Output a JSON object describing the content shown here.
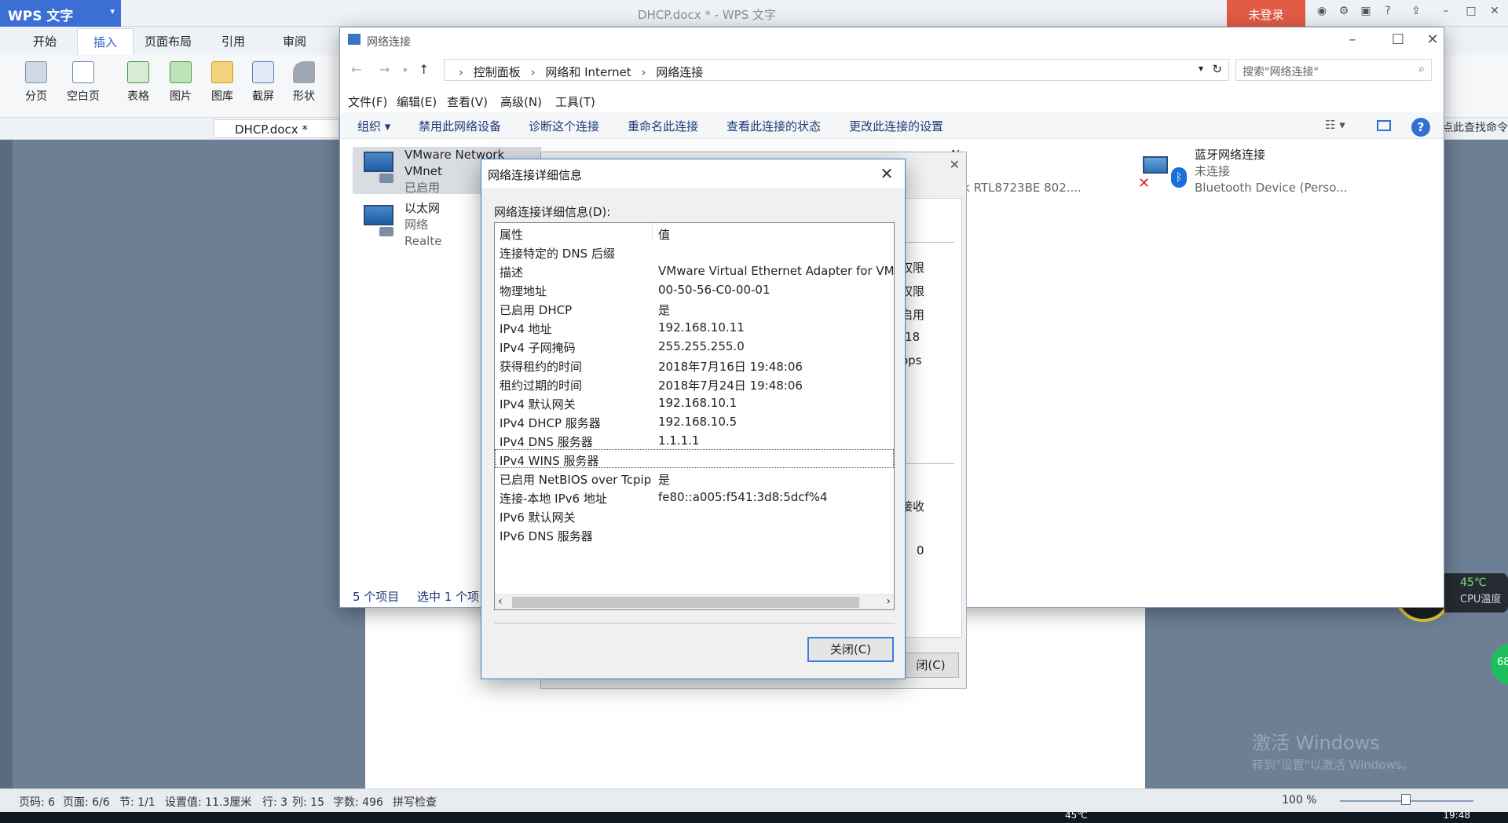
{
  "wps": {
    "app_name": "WPS 文字",
    "window_title": "DHCP.docx * - WPS 文字",
    "login_label": "未登录",
    "tabs": [
      "开始",
      "插入",
      "页面布局",
      "引用",
      "审阅"
    ],
    "active_tab": "插入",
    "ribbon": [
      "分页",
      "空白页",
      "表格",
      "图片",
      "图库",
      "截屏",
      "形状"
    ],
    "doc_tab": "DHCP.docx *",
    "find_hint": "点此查找命令",
    "status": {
      "page_code": "页码: 6",
      "pages": "页面: 6/6",
      "section": "节: 1/1",
      "setting": "设置值: 11.3厘米",
      "row": "行: 3",
      "col": "列: 15",
      "words": "字数: 496",
      "spell": "拼写检查",
      "zoom": "100 %"
    }
  },
  "watermark": {
    "line1": "激活 Windows",
    "line2": "转到\"设置\"以激活 Windows。"
  },
  "cpu": {
    "percent": "68",
    "unit": "%",
    "temp": "45℃",
    "label": "CPU温度",
    "ball": "68"
  },
  "taskbar": {
    "time": "19:48",
    "temp": "45℃"
  },
  "nc": {
    "title": "网络连接",
    "path": [
      "控制面板",
      "网络和 Internet",
      "网络连接"
    ],
    "search_placeholder": "搜索\"网络连接\"",
    "menu": [
      "文件(F)",
      "编辑(E)",
      "查看(V)",
      "高级(N)",
      "工具(T)"
    ],
    "commands": [
      "组织 ▾",
      "禁用此网络设备",
      "诊断这个连接",
      "重命名此连接",
      "查看此连接的状态",
      "更改此连接的设置"
    ],
    "items": [
      {
        "name": "VMware Network",
        "line2": "VMnet",
        "line3": "已启用"
      },
      {
        "name": "以太网",
        "line2": "网络",
        "line3": "Realte"
      },
      {
        "name": "N",
        "line2": "接",
        "line3": "tek RTL8723BE 802...."
      },
      {
        "name": "蓝牙网络连接",
        "line2": "未连接",
        "line3": "Bluetooth Device (Perso..."
      }
    ],
    "status_count": "5 个项目",
    "status_sel": "选中 1 个项"
  },
  "status_dialog": {
    "frags": [
      "权限",
      "权限",
      "启用",
      ":18",
      "ops",
      "接收",
      "0"
    ],
    "close": "闭(C)"
  },
  "details": {
    "title": "网络连接详细信息",
    "label": "网络连接详细信息(D):",
    "col_prop": "属性",
    "col_val": "值",
    "rows": [
      {
        "k": "连接特定的 DNS 后缀",
        "v": ""
      },
      {
        "k": "描述",
        "v": "VMware Virtual Ethernet Adapter for VMnet1"
      },
      {
        "k": "物理地址",
        "v": "00-50-56-C0-00-01"
      },
      {
        "k": "已启用 DHCP",
        "v": "是"
      },
      {
        "k": "IPv4 地址",
        "v": "192.168.10.11"
      },
      {
        "k": "IPv4 子网掩码",
        "v": "255.255.255.0"
      },
      {
        "k": "获得租约的时间",
        "v": "2018年7月16日 19:48:06"
      },
      {
        "k": "租约过期的时间",
        "v": "2018年7月24日 19:48:06"
      },
      {
        "k": "IPv4 默认网关",
        "v": "192.168.10.1"
      },
      {
        "k": "IPv4 DHCP 服务器",
        "v": "192.168.10.5"
      },
      {
        "k": "IPv4 DNS 服务器",
        "v": "1.1.1.1"
      },
      {
        "k": "IPv4 WINS 服务器",
        "v": ""
      },
      {
        "k": "已启用 NetBIOS over Tcpip",
        "v": "是"
      },
      {
        "k": "连接-本地 IPv6 地址",
        "v": "fe80::a005:f541:3d8:5dcf%4"
      },
      {
        "k": "IPv6 默认网关",
        "v": ""
      },
      {
        "k": "IPv6 DNS 服务器",
        "v": ""
      }
    ],
    "close_btn": "关闭(C)"
  }
}
